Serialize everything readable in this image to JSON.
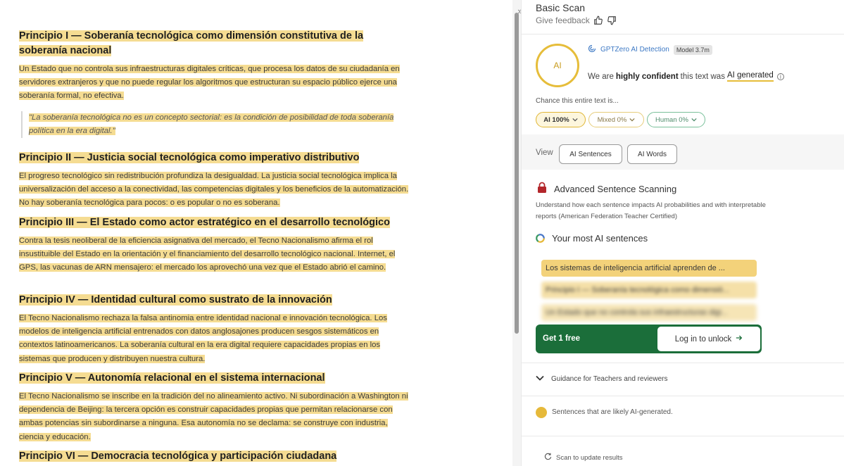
{
  "document": {
    "sections": [
      {
        "heading": "Principio I — Soberanía tecnológica como dimensión constitutiva de la soberanía nacional",
        "paragraphs": [
          "Un Estado que no controla sus infraestructuras digitales críticas, que procesa los datos de su ciudadanía en servidores extranjeros y que no puede regular los algoritmos que estructuran su espacio público ejerce una soberanía formal, no efectiva."
        ],
        "quote": "\"La soberanía tecnológica no es un concepto sectorial: es la condición de posibilidad de toda soberanía política en la era digital.\""
      },
      {
        "heading": "Principio II — Justicia social tecnológica como imperativo distributivo",
        "p_plain": "El progreso tecnológico sin redistribución profundiza la desigualdad. ",
        "p_hl": "La justicia social tecnológica implica la universalización del acceso a la conectividad, las competencias digitales y los beneficios de la automatización. No hay soberanía tecnológica para pocos: o es popular o no es soberana."
      },
      {
        "heading": "Principio III — El Estado como actor estratégico en el desarrollo tecnológico",
        "p_hl": "Contra la tesis neoliberal de la eficiencia asignativa del mercado, el Tecno Nacionalismo afirma el rol insustituible del Estado en la orientación y el financiamiento del desarrollo tecnológico nacional. Internet, el GPS, las vacunas de ARN mensajero: el mercado los aprovechó una vez que el Estado abrió el camino."
      },
      {
        "heading": "Principio IV — Identidad cultural como sustrato de la innovación",
        "p_hl": "El Tecno Nacionalismo rechaza la falsa antinomia entre identidad nacional e innovación tecnológica. Los modelos de inteligencia artificial entrenados con datos anglosajones producen sesgos sistemáticos en contextos latinoamericanos. La soberanía cultural en la era digital requiere capacidades propias en los sistemas que producen y distribuyen nuestra cultura."
      },
      {
        "heading": "Principio V — Autonomía relacional en el sistema internacional",
        "p_hl": "El Tecno Nacionalismo se inscribe en la tradición del no alineamiento activo. Ni subordinación a Washington ni dependencia de Beijing: la tercera opción es construir capacidades propias que permitan relacionarse con ambas potencias sin subordinarse a ninguna. Esa autonomía no se declama: se construye con industria, ciencia y educación."
      },
      {
        "heading": "Principio VI — Democracia tecnológica y participación ciudadana"
      }
    ]
  },
  "panel": {
    "title": "Basic Scan",
    "feedback": "Give feedback",
    "circle_label": "AI",
    "detector": "GPTZero AI Detection",
    "model": "Model 3.7m",
    "confident_pre": "We are ",
    "confident_bold": "highly confident",
    "confident_mid": " this text was ",
    "confident_result": "AI generated",
    "chance_label": "Chance this entire text is...",
    "pills": {
      "ai": "AI 100%",
      "mixed": "Mixed 0%",
      "human": "Human 0%"
    },
    "view_label": "View",
    "view_buttons": {
      "sentences": "AI Sentences",
      "words": "AI Words"
    },
    "advanced_title": "Advanced Sentence Scanning",
    "advanced_desc": "Understand how each sentence impacts AI probabilities and with interpretable reports (American Federation Teacher Certified)",
    "most_ai_title": "Your most AI sentences",
    "sentences": [
      "Los sistemas de inteligencia artificial aprenden de ...",
      "Principio I — Soberanía tecnológica como dimensió...",
      "Un Estado que no controla sus infraestructuras digi..."
    ],
    "get_free": "Get 1 free",
    "login": "Log in to unlock",
    "guidance": "Guidance for Teachers and reviewers",
    "legend": "Sentences that are likely AI-generated.",
    "rescan": "Scan to update results",
    "colors": {
      "ai_yellow": "#e6b93a",
      "unlock_green": "#1b6e3a",
      "human_green": "#79c09a"
    }
  }
}
